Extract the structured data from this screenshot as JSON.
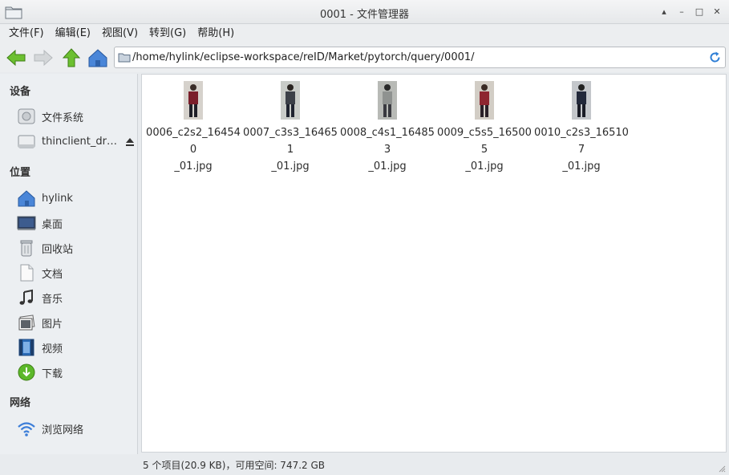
{
  "window": {
    "title": "0001 - 文件管理器",
    "controls": [
      "up-icon",
      "minimize-icon",
      "maximize-icon",
      "close-icon"
    ]
  },
  "menubar": {
    "items": [
      "文件(F)",
      "编辑(E)",
      "视图(V)",
      "转到(G)",
      "帮助(H)"
    ]
  },
  "toolbar": {
    "icons": [
      "back-arrow-icon",
      "forward-arrow-icon",
      "up-arrow-icon",
      "home-icon"
    ],
    "location": "/home/hylink/eclipse-workspace/reID/Market/pytorch/query/0001/"
  },
  "sidebar": {
    "devices_title": "设备",
    "devices": [
      {
        "label": "文件系统",
        "icon": "harddisk-icon"
      },
      {
        "label": "thinclient_dr…",
        "icon": "drive-icon"
      }
    ],
    "places_title": "位置",
    "places": [
      {
        "label": "hylink",
        "icon": "home-icon"
      },
      {
        "label": "桌面",
        "icon": "desktop-icon"
      },
      {
        "label": "回收站",
        "icon": "trash-icon"
      },
      {
        "label": "文档",
        "icon": "document-icon"
      },
      {
        "label": "音乐",
        "icon": "music-icon"
      },
      {
        "label": "图片",
        "icon": "pictures-icon"
      },
      {
        "label": "视频",
        "icon": "video-icon"
      },
      {
        "label": "下载",
        "icon": "download-icon"
      }
    ],
    "network_title": "网络",
    "network": [
      {
        "label": "浏览网络",
        "icon": "wifi-icon"
      }
    ]
  },
  "files": [
    {
      "line1": "0006_c2s2_164540",
      "line2": "_01.jpg",
      "color": "#7a1e2a"
    },
    {
      "line1": "0007_c3s3_164651",
      "line2": "_01.jpg",
      "color": "#3c4048"
    },
    {
      "line1": "0008_c4s1_164853",
      "line2": "_01.jpg",
      "color": "#8f9290"
    },
    {
      "line1": "0009_c5s5_165005",
      "line2": "_01.jpg",
      "color": "#8e2630"
    },
    {
      "line1": "0010_c2s3_165107",
      "line2": "_01.jpg",
      "color": "#22283a"
    }
  ],
  "status": "5 个项目(20.9 KB)，可用空间: 747.2 GB",
  "colors": {
    "accent_blue": "#3b7dd8",
    "nav_green": "#5cb82a"
  }
}
